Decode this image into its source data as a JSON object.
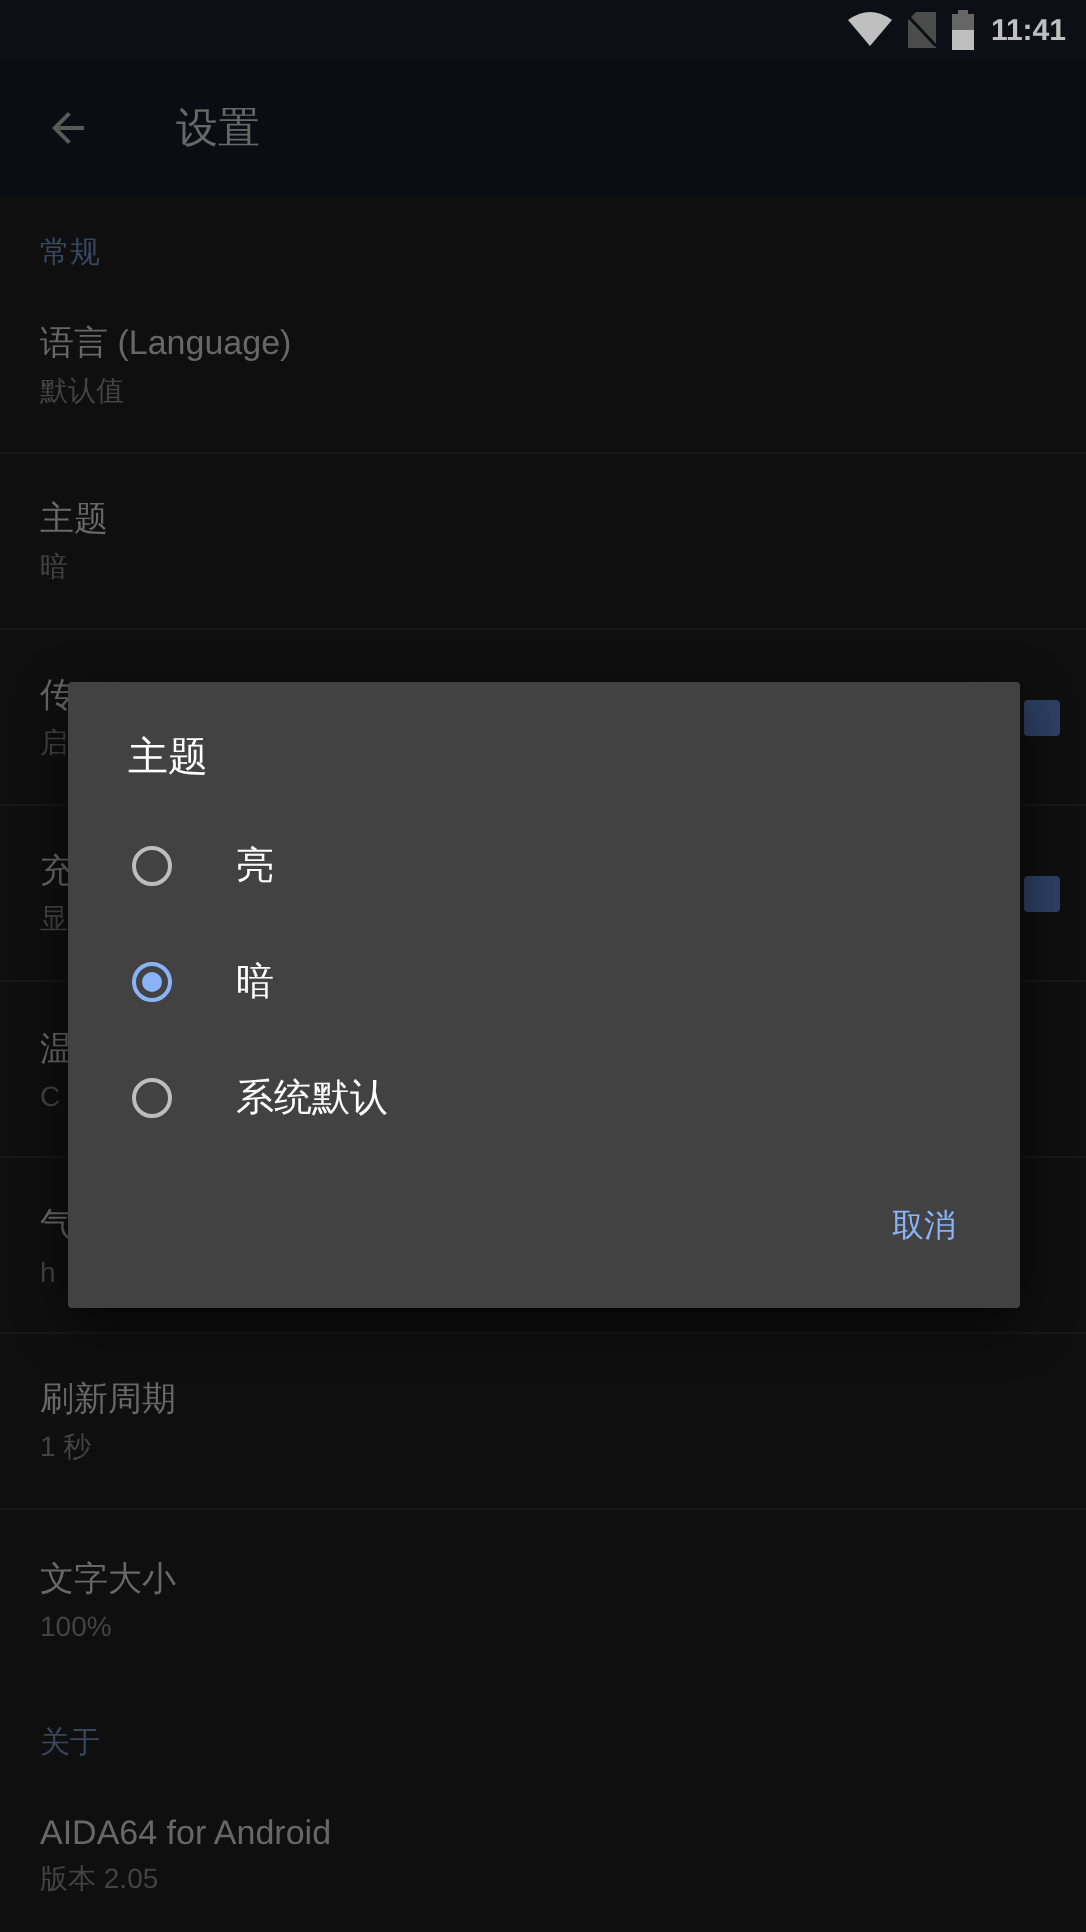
{
  "status_bar": {
    "time": "11:41"
  },
  "toolbar": {
    "title": "设置"
  },
  "sections": [
    {
      "header": "常规",
      "items": [
        {
          "title": "语言 (Language)",
          "summary": "默认值"
        },
        {
          "title": "主题",
          "summary": "暗"
        },
        {
          "title": "传",
          "summary": "启",
          "checked": true
        },
        {
          "title": "充",
          "summary": "显",
          "checked": true
        },
        {
          "title": "温",
          "summary": "C"
        },
        {
          "title": "气",
          "summary": "h"
        },
        {
          "title": "刷新周期",
          "summary": "1 秒"
        },
        {
          "title": "文字大小",
          "summary": "100%"
        }
      ]
    },
    {
      "header": "关于",
      "items": [
        {
          "title": "AIDA64 for Android",
          "summary": "版本 2.05"
        }
      ]
    }
  ],
  "dialog": {
    "title": "主题",
    "options": [
      {
        "label": "亮",
        "selected": false
      },
      {
        "label": "暗",
        "selected": true
      },
      {
        "label": "系统默认",
        "selected": false
      }
    ],
    "buttons": [
      "取消"
    ]
  }
}
